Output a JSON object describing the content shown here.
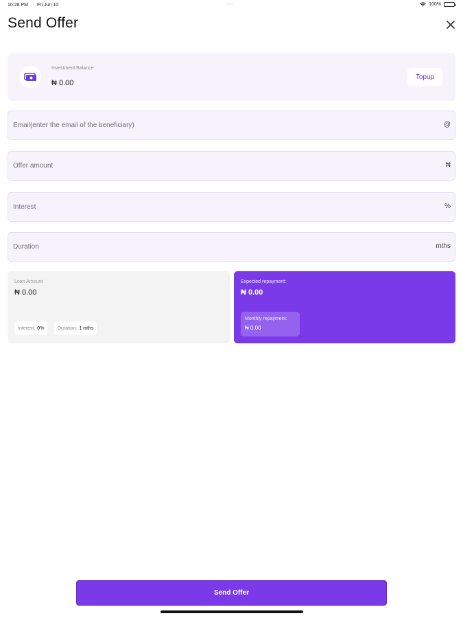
{
  "status_bar": {
    "time": "10:28 PM",
    "date": "Fri Jun 10",
    "battery": "100%"
  },
  "header": {
    "title": "Send Offer"
  },
  "balance": {
    "label": "Investment Balance",
    "value": "₦ 0.00",
    "topup_label": "Topup"
  },
  "form": {
    "email": {
      "placeholder": "Email(enter the email of the beneficiary)",
      "suffix": "@"
    },
    "offer_amount": {
      "placeholder": "Offer amount",
      "suffix": "₦"
    },
    "interest": {
      "placeholder": "Interest",
      "suffix": "%"
    },
    "duration": {
      "placeholder": "Duration",
      "suffix": "mths"
    }
  },
  "loan_summary": {
    "label": "Loan Amount",
    "value": "₦ 0.00",
    "interest_key": "Interest:",
    "interest_value": "0%",
    "duration_key": "Duration:",
    "duration_value": "1 mths"
  },
  "repayment": {
    "label": "Expected repayment:",
    "value": "₦ 0.00",
    "monthly_label": "Monthly repayment:",
    "monthly_value": "₦ 0.00"
  },
  "footer": {
    "send_label": "Send Offer"
  },
  "colors": {
    "accent": "#7b3aea",
    "field_bg": "#f6f3fd",
    "card_gray": "#f3f3f3"
  }
}
